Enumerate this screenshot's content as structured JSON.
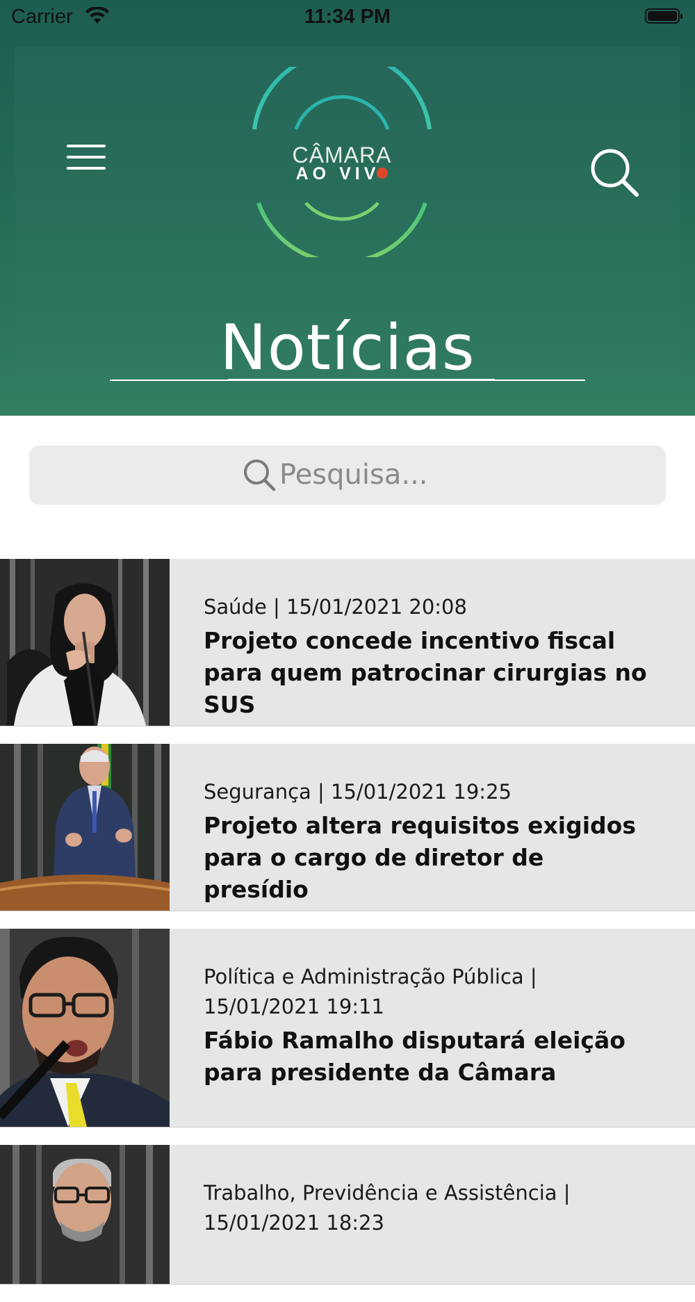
{
  "status_bar": {
    "carrier": "Carrier",
    "time": "11:34 PM"
  },
  "header": {
    "logo_line1": "CÂMARA",
    "logo_line2": "AO VIV",
    "title": "Notícias"
  },
  "search": {
    "placeholder": "Pesquisa..."
  },
  "news": [
    {
      "meta": "Saúde | 15/01/2021 20:08",
      "headline": "Projeto concede incentivo fiscal para quem patrocinar cirurgias no SUS"
    },
    {
      "meta": "Segurança | 15/01/2021 19:25",
      "headline": "Projeto altera requisitos exigidos para o cargo de diretor de presídio"
    },
    {
      "meta": "Política e Administração Pública | 15/01/2021 19:11",
      "headline": "Fábio Ramalho disputará eleição para presidente da Câmara"
    },
    {
      "meta": "Trabalho, Previdência e Assistência | 15/01/2021 18:23",
      "headline": ""
    }
  ],
  "colors": {
    "header_top": "#1d5e52",
    "header_bottom": "#327f61",
    "item_bg": "#e6e6e6",
    "logo_dot": "#e0472a"
  },
  "icons": [
    "wifi-icon",
    "battery-icon",
    "menu-icon",
    "search-icon"
  ]
}
